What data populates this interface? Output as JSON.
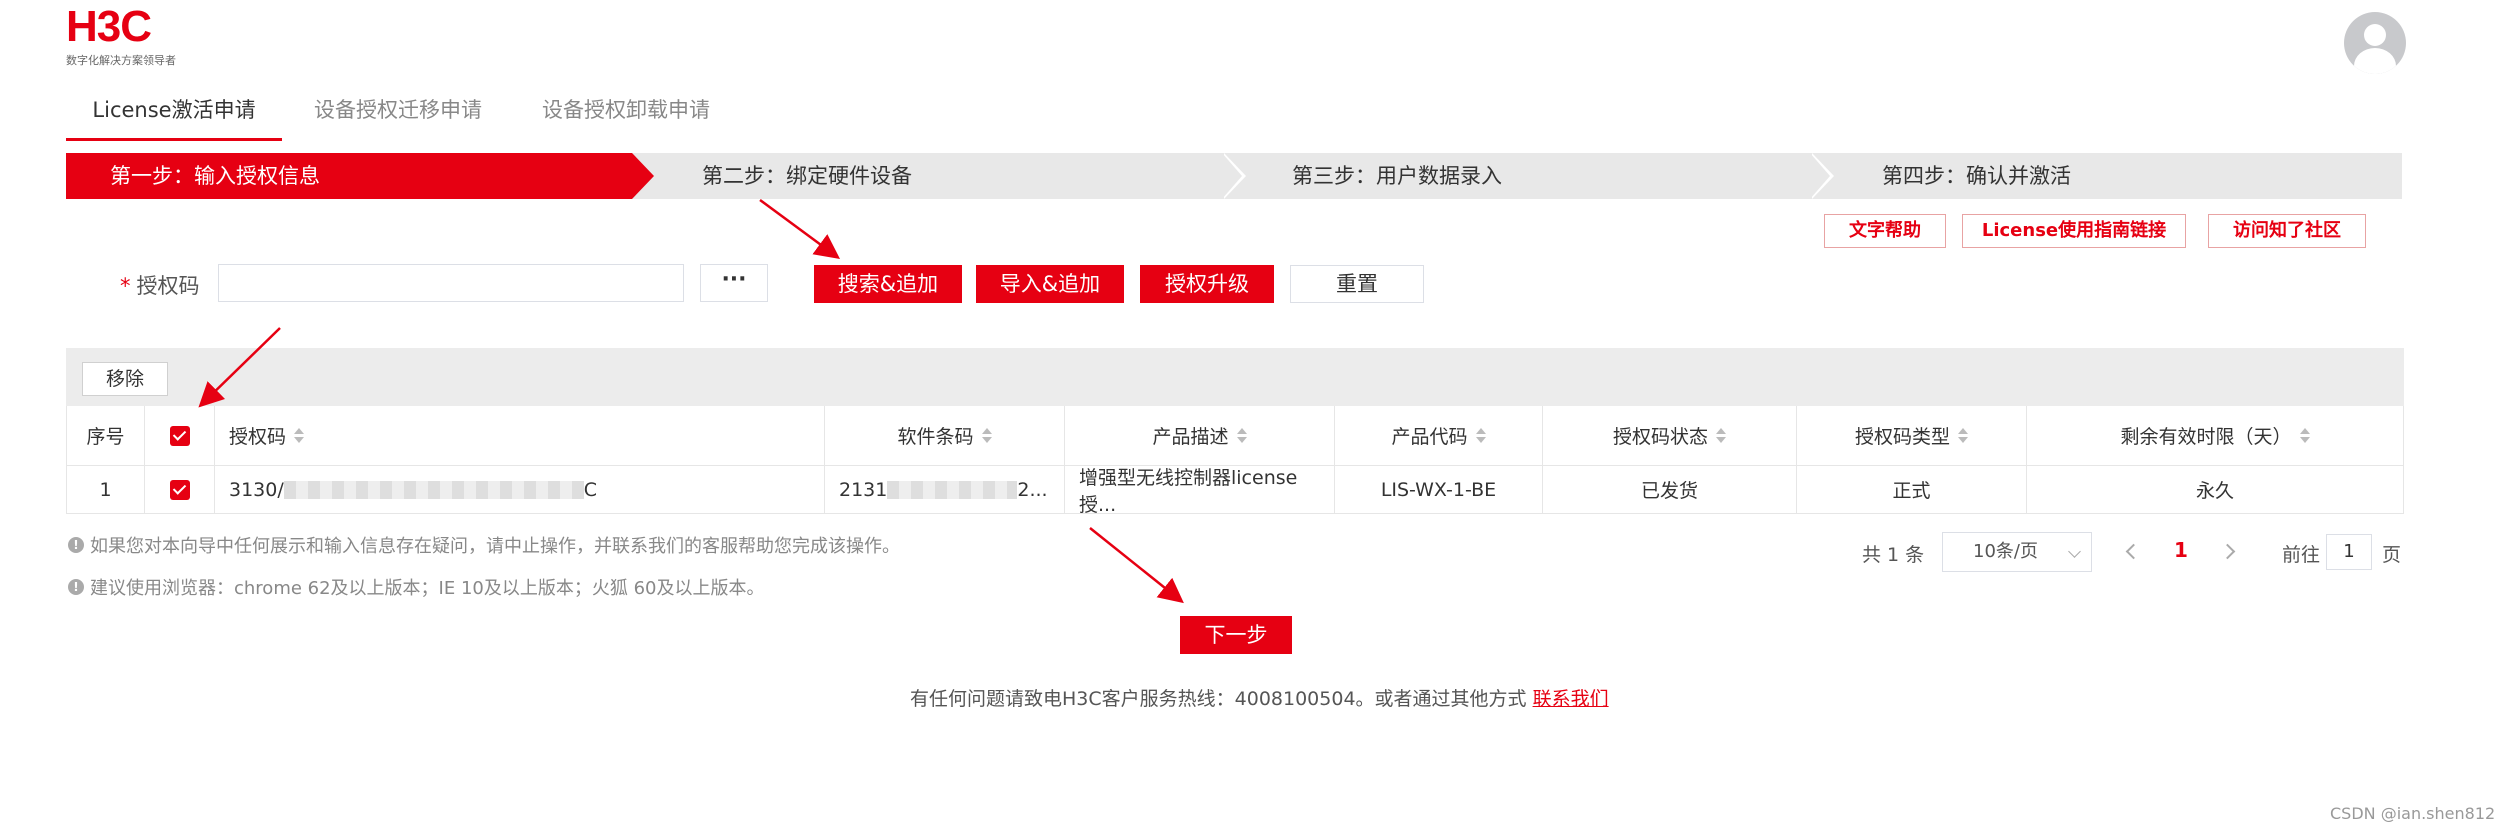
{
  "header": {
    "logo": "H3C",
    "logo_tagline": "数字化解决方案领导者"
  },
  "tabs": [
    {
      "label": "License激活申请",
      "active": true
    },
    {
      "label": "设备授权迁移申请",
      "active": false
    },
    {
      "label": "设备授权卸载申请",
      "active": false
    }
  ],
  "steps": [
    {
      "label": "第一步：输入授权信息",
      "active": true
    },
    {
      "label": "第二步：绑定硬件设备",
      "active": false
    },
    {
      "label": "第三步：用户数据录入",
      "active": false
    },
    {
      "label": "第四步：确认并激活",
      "active": false
    }
  ],
  "help_links": {
    "text_help": "文字帮助",
    "guide_link": "License使用指南链接",
    "community": "访问知了社区"
  },
  "form": {
    "required_mark": "*",
    "auth_code_label": "授权码",
    "auth_code_value": "",
    "more_button": "···",
    "search_add": "搜索&追加",
    "import_add": "导入&追加",
    "upgrade": "授权升级",
    "reset": "重置"
  },
  "table": {
    "remove_button": "移除",
    "columns": [
      "序号",
      "",
      "授权码",
      "软件条码",
      "产品描述",
      "产品代码",
      "授权码状态",
      "授权码类型",
      "剩余有效时限（天）"
    ],
    "rows": [
      {
        "index": "1",
        "checked": true,
        "auth_code_prefix": "3130/",
        "auth_code_suffix": "C",
        "software_code_prefix": "2131",
        "software_code_suffix": "2...",
        "description": "增强型无线控制器license授...",
        "product_code": "LIS-WX-1-BE",
        "status": "已发货",
        "type": "正式",
        "remaining": "永久"
      }
    ]
  },
  "notes": [
    "如果您对本向导中任何展示和输入信息存在疑问，请中止操作，并联系我们的客服帮助您完成该操作。",
    "建议使用浏览器：chrome 62及以上版本；IE 10及以上版本；火狐 60及以上版本。"
  ],
  "pagination": {
    "total": "共 1 条",
    "page_size": "10条/页",
    "current_page": "1",
    "goto_label": "前往",
    "goto_value": "1",
    "page_unit": "页"
  },
  "next_button": "下一步",
  "footer": {
    "text": "有任何问题请致电H3C客户服务热线：4008100504。或者通过其他方式 ",
    "link": "联系我们"
  },
  "watermark": "CSDN @ian.shen812",
  "colors": {
    "brand": "#e60012",
    "step_bg": "#e8e8e8"
  }
}
